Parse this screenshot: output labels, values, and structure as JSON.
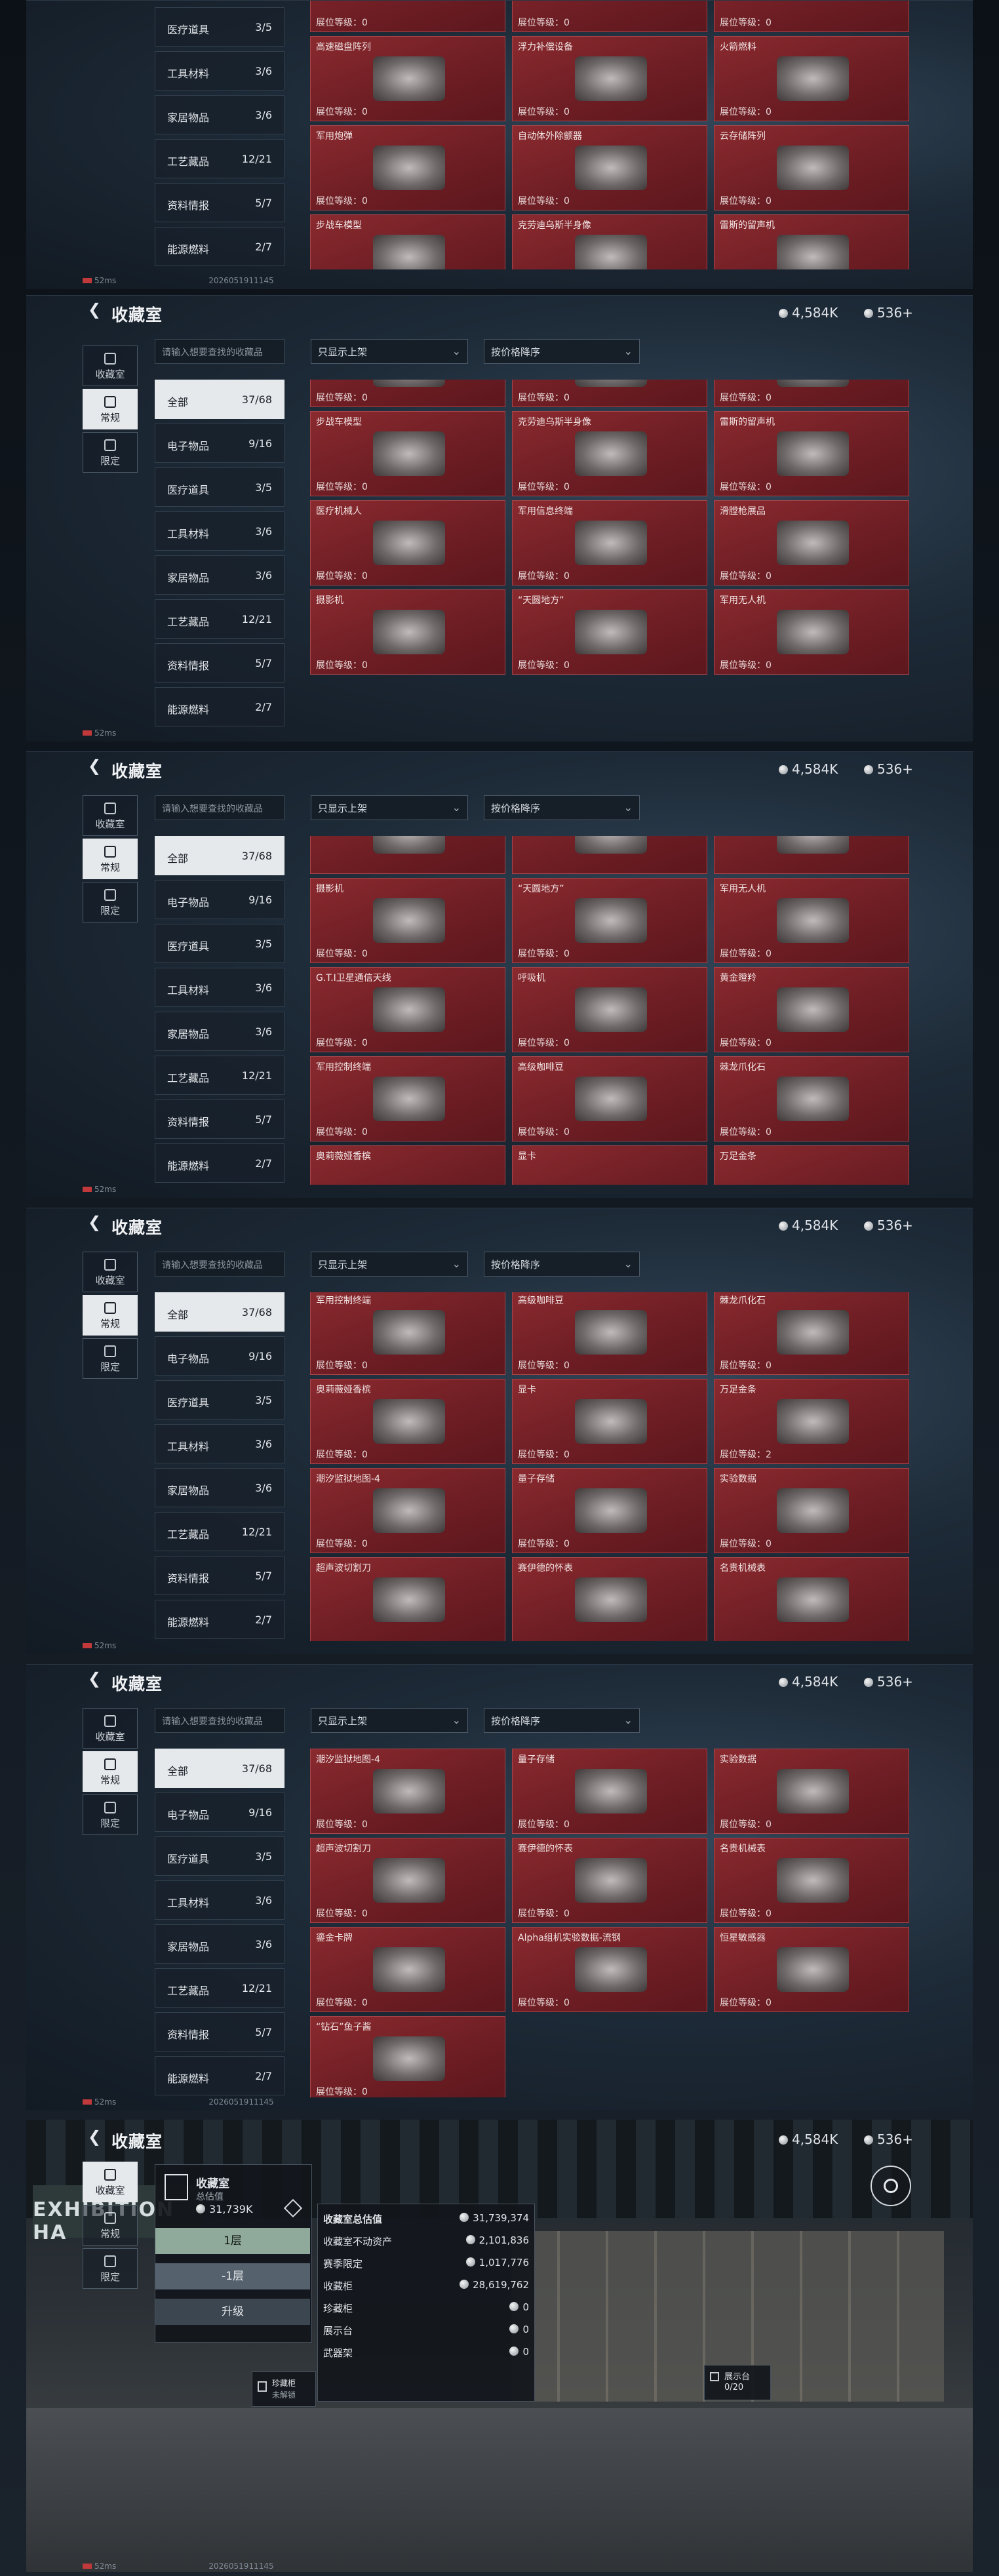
{
  "header": {
    "back_icon": "chevron-left-icon",
    "title": "收藏室",
    "currency1": "4,584K",
    "currency2": "536+"
  },
  "left_nav": [
    {
      "label": "收藏室",
      "icon": "trophy-icon"
    },
    {
      "label": "常规",
      "icon": "card-icon"
    },
    {
      "label": "限定",
      "icon": "frame-icon"
    }
  ],
  "search": {
    "placeholder": "请输入想要查找的收藏品"
  },
  "filters": {
    "show": "只显示上架",
    "sort": "按价格降序"
  },
  "categories": [
    {
      "name": "全部",
      "count": "37/68"
    },
    {
      "name": "电子物品",
      "count": "9/16"
    },
    {
      "name": "医疗道具",
      "count": "3/5"
    },
    {
      "name": "工具材料",
      "count": "3/6"
    },
    {
      "name": "家居物品",
      "count": "3/6"
    },
    {
      "name": "工艺藏品",
      "count": "12/21"
    },
    {
      "name": "资料情报",
      "count": "5/7"
    },
    {
      "name": "能源燃料",
      "count": "2/7"
    }
  ],
  "level_prefix": "展位等级：",
  "items": [
    {
      "name": "高速磁盘阵列",
      "level": "0"
    },
    {
      "name": "浮力补偿设备",
      "level": "0"
    },
    {
      "name": "火箭燃料",
      "level": "0"
    },
    {
      "name": "军用炮弹",
      "level": "0"
    },
    {
      "name": "自动体外除颤器",
      "level": "0"
    },
    {
      "name": "云存储阵列",
      "level": "0"
    },
    {
      "name": "步战车模型",
      "level": "0"
    },
    {
      "name": "克劳迪乌斯半身像",
      "level": "0"
    },
    {
      "name": "雷斯的留声机",
      "level": "0"
    },
    {
      "name": "医疗机械人",
      "level": "0"
    },
    {
      "name": "军用信息终端",
      "level": "0"
    },
    {
      "name": "滑膛枪展品",
      "level": "0"
    },
    {
      "name": "摄影机",
      "level": "0"
    },
    {
      "name": "“天圆地方”",
      "level": "0"
    },
    {
      "name": "军用无人机",
      "level": "0"
    },
    {
      "name": "G.T.I卫星通信天线",
      "level": "0"
    },
    {
      "name": "呼吸机",
      "level": "0"
    },
    {
      "name": "黄金瞪羚",
      "level": "0"
    },
    {
      "name": "军用控制终端",
      "level": "0"
    },
    {
      "name": "高级咖啡豆",
      "level": "0"
    },
    {
      "name": "棘龙爪化石",
      "level": "0"
    },
    {
      "name": "奥莉薇娅香槟",
      "level": "0"
    },
    {
      "name": "显卡",
      "level": "0"
    },
    {
      "name": "万足金条",
      "level": "2"
    },
    {
      "name": "潮汐监狱地图-4",
      "level": "0"
    },
    {
      "name": "量子存储",
      "level": "0"
    },
    {
      "name": "实验数据",
      "level": "0"
    },
    {
      "name": "超声波切割刀",
      "level": "0"
    },
    {
      "name": "赛伊德的怀表",
      "level": "0"
    },
    {
      "name": "名贵机械表",
      "level": "0"
    },
    {
      "name": "鎏金卡牌",
      "level": "0"
    },
    {
      "name": "Alpha组机实验数据-流钢",
      "level": "0"
    },
    {
      "name": "恒星敏感器",
      "level": "0"
    },
    {
      "name": "“钻石”鱼子酱",
      "level": "0"
    }
  ],
  "status": {
    "ping": "52ms",
    "build": "2026051911145"
  },
  "exhibition": {
    "title": "收藏室",
    "room_label": "收藏室",
    "valuation_label": "总估值",
    "valuation": "31,739K",
    "floor1": "1层",
    "floor2": "-1层",
    "upgrade": "升级",
    "wall_text": "EXHIBITION HA",
    "summary_title": "收藏室总估值",
    "summary_total": "31,739,374",
    "rows": [
      {
        "k": "收藏室不动资产",
        "v": "2,101,836"
      },
      {
        "k": "赛季限定",
        "v": "1,017,776"
      },
      {
        "k": "收藏柜",
        "v": "28,619,762"
      },
      {
        "k": "珍藏柜",
        "v": "0"
      },
      {
        "k": "展示台",
        "v": "0"
      },
      {
        "k": "武器架",
        "v": "0"
      }
    ],
    "locked1": "珍藏柜",
    "locked2": "未解锁",
    "stand_label": "展示台",
    "stand_count": "0/20"
  }
}
